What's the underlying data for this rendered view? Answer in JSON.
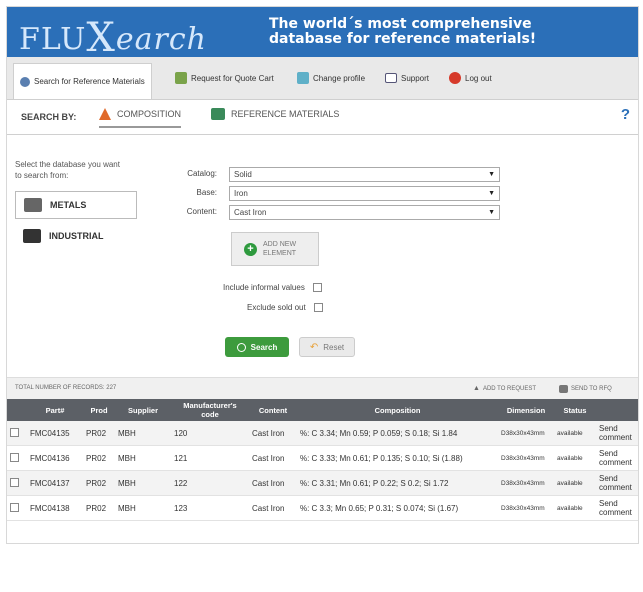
{
  "header": {
    "logo_flu": "FLU",
    "logo_x": "X",
    "logo_earch": "earch",
    "tagline_line1": "The world´s most comprehensive",
    "tagline_line2": "database for reference materials!"
  },
  "nav": {
    "search": "Search for Reference Materials",
    "request": "Request for Quote Cart",
    "profile": "Change profile",
    "support": "Support",
    "logout": "Log out"
  },
  "search_by": {
    "label": "SEARCH BY:",
    "composition": "COMPOSITION",
    "reference": "REFERENCE MATERIALS",
    "help": "?"
  },
  "databases": {
    "prompt": "Select the database you want to search from:",
    "metals": "METALS",
    "industrial": "INDUSTRIAL"
  },
  "form": {
    "catalog_label": "Catalog:",
    "catalog_value": "Solid",
    "base_label": "Base:",
    "base_value": "Iron",
    "content_label": "Content:",
    "content_value": "Cast Iron",
    "add_new": "ADD NEW",
    "element": "ELEMENT",
    "include_informal": "Include informal values",
    "exclude_sold_out": "Exclude sold out",
    "search_btn": "Search",
    "reset_btn": "Reset"
  },
  "results": {
    "total": "TOTAL NUMBER OF RECORDS: 227",
    "add_to_request": "ADD TO REQUEST",
    "send_to_rfq": "SEND TO RFQ",
    "columns": [
      "",
      "Part#",
      "Prod",
      "Supplier",
      "Manufacturer's code",
      "Content",
      "Composition",
      "Dimension",
      "Status",
      ""
    ],
    "rows": [
      {
        "part": "FMC04135",
        "prod": "PR02",
        "supplier": "MBH",
        "code": "120",
        "content": "Cast Iron",
        "composition": "%: C 3.34; Mn 0.59; P 0.059; S 0.18; Si 1.84",
        "dimension": "D38x30x43mm",
        "status": "available",
        "comment": "Send comment"
      },
      {
        "part": "FMC04136",
        "prod": "PR02",
        "supplier": "MBH",
        "code": "121",
        "content": "Cast Iron",
        "composition": "%: C 3.33; Mn 0.61; P 0.135; S 0.10; Si (1.88)",
        "dimension": "D38x30x43mm",
        "status": "available",
        "comment": "Send comment"
      },
      {
        "part": "FMC04137",
        "prod": "PR02",
        "supplier": "MBH",
        "code": "122",
        "content": "Cast Iron",
        "composition": "%: C 3.31; Mn 0.61; P 0.22; S 0.2; Si 1.72",
        "dimension": "D38x30x43mm",
        "status": "available",
        "comment": "Send comment"
      },
      {
        "part": "FMC04138",
        "prod": "PR02",
        "supplier": "MBH",
        "code": "123",
        "content": "Cast Iron",
        "composition": "%: C 3.3; Mn 0.65; P 0.31; S 0.074; Si (1.67)",
        "dimension": "D38x30x43mm",
        "status": "available",
        "comment": "Send comment"
      }
    ]
  },
  "colors": {
    "header_blue": "#2b6fb8",
    "search_green": "#3d9b3d",
    "table_header": "#5c6066"
  }
}
